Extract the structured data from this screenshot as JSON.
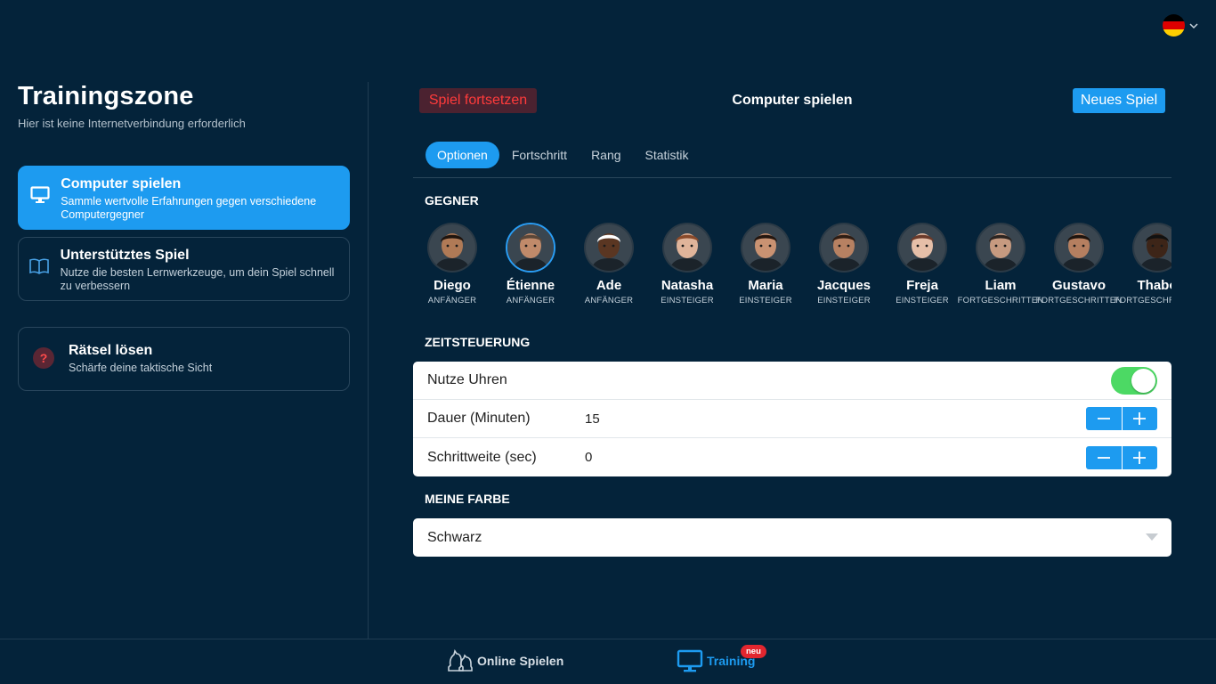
{
  "language": {
    "flag": "flag-germany-icon",
    "colors": [
      "#000000",
      "#dd0000",
      "#ffce00"
    ]
  },
  "left": {
    "title": "Trainingszone",
    "subtitle": "Hier ist keine Internetverbindung erforderlich",
    "modes": [
      {
        "title": "Computer spielen",
        "desc": "Sammle wertvolle Erfahrungen gegen verschiedene Computergegner",
        "icon": "monitor-icon",
        "active": true
      },
      {
        "title": "Unterstütztes Spiel",
        "desc": "Nutze die besten Lernwerkzeuge, um dein Spiel schnell zu verbessern",
        "icon": "book-icon",
        "active": false
      },
      {
        "title": "Rätsel lösen",
        "desc": "Schärfe deine taktische Sicht",
        "icon": "question-icon",
        "active": false
      }
    ]
  },
  "header": {
    "continue_label": "Spiel fortsetzen",
    "title": "Computer spielen",
    "new_game_label": "Neues Spiel"
  },
  "tabs": [
    {
      "label": "Optionen",
      "active": true
    },
    {
      "label": "Fortschritt",
      "active": false
    },
    {
      "label": "Rang",
      "active": false
    },
    {
      "label": "Statistik",
      "active": false
    }
  ],
  "sections": {
    "opponents": "GEGNER",
    "time_control": "ZEITSTEUERUNG",
    "my_color": "MEINE FARBE"
  },
  "opponents": [
    {
      "name": "Diego",
      "level": "ANFÄNGER",
      "skin": "#b07a56",
      "hair": "#1f140e"
    },
    {
      "name": "Étienne",
      "level": "ANFÄNGER",
      "skin": "#c08a6a",
      "hair": "#5a4638",
      "selected": true
    },
    {
      "name": "Ade",
      "level": "ANFÄNGER",
      "skin": "#5a3622",
      "hair": "#ffffff"
    },
    {
      "name": "Natasha",
      "level": "EINSTEIGER",
      "skin": "#e0b49a",
      "hair": "#8a4a2a"
    },
    {
      "name": "Maria",
      "level": "EINSTEIGER",
      "skin": "#c99272",
      "hair": "#24160f"
    },
    {
      "name": "Jacques",
      "level": "EINSTEIGER",
      "skin": "#b78162",
      "hair": "#2e1d14"
    },
    {
      "name": "Freja",
      "level": "EINSTEIGER",
      "skin": "#e6bfa8",
      "hair": "#6b3a2a"
    },
    {
      "name": "Liam",
      "level": "FORTGESCHRITTEN",
      "skin": "#c69a80",
      "hair": "#2c2420"
    },
    {
      "name": "Gustavo",
      "level": "FORTGESCHRITTEN",
      "skin": "#b57f60",
      "hair": "#1e140e"
    },
    {
      "name": "Thabo",
      "level": "FORTGESCHRITTEN",
      "skin": "#3d2518",
      "hair": "#111111"
    }
  ],
  "time_control": {
    "use_clock_label": "Nutze Uhren",
    "use_clock_on": true,
    "duration_label": "Dauer (Minuten)",
    "duration_value": "15",
    "increment_label": "Schrittweite (sec)",
    "increment_value": "0"
  },
  "color_select": {
    "value": "Schwarz"
  },
  "bottom_nav": {
    "online_label": "Online Spielen",
    "training_label": "Training",
    "training_badge": "neu"
  },
  "colors": {
    "accent": "#1d9bf0",
    "background": "#04233a",
    "danger": "#ff3b3b",
    "toggle_on": "#4cd964"
  }
}
